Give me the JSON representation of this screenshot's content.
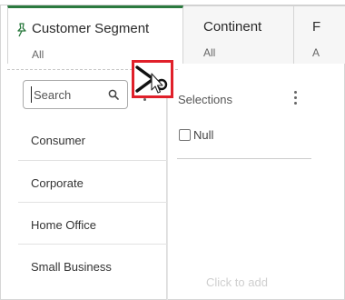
{
  "tabs": [
    {
      "title": "Customer Segment",
      "subtitle": "All"
    },
    {
      "title": "Continent",
      "subtitle": "All"
    },
    {
      "title": "F",
      "subtitle": "A"
    }
  ],
  "search": {
    "placeholder": "Search"
  },
  "list_items": [
    "Consumer",
    "Corporate",
    "Home Office",
    "Small Business"
  ],
  "selections": {
    "label": "Selections",
    "null_option": "Null",
    "click_to_add": "Click to add"
  },
  "colors": {
    "active_tab_accent": "#2b7a3f",
    "highlight_box": "#e0202a"
  }
}
